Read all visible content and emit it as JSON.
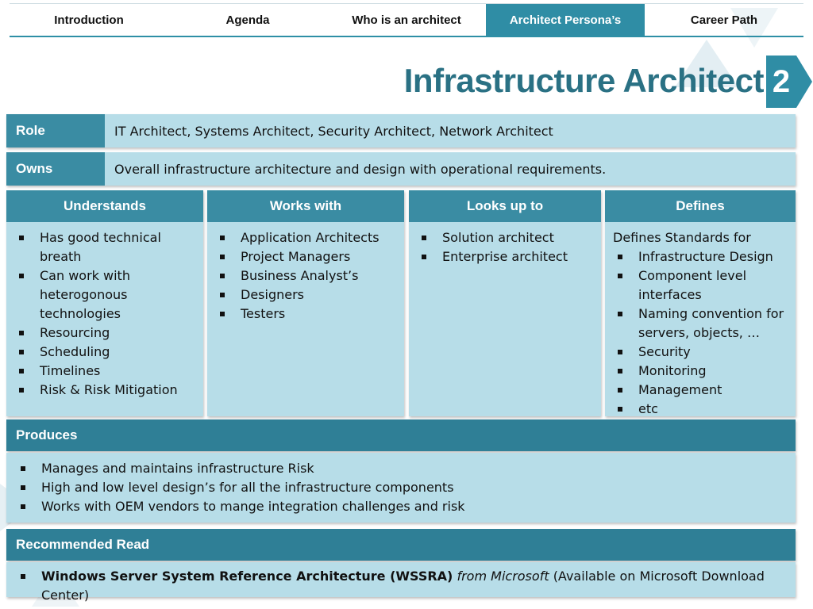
{
  "nav": {
    "tabs": [
      {
        "label": "Introduction"
      },
      {
        "label": "Agenda"
      },
      {
        "label": "Who is an architect"
      },
      {
        "label": "Architect Persona’s"
      },
      {
        "label": "Career Path"
      }
    ]
  },
  "title": "Infrastructure Architect",
  "slide_number": "2",
  "role": {
    "label": "Role",
    "text": "IT Architect, Systems Architect, Security Architect, Network Architect"
  },
  "owns": {
    "label": "Owns",
    "text": "Overall infrastructure architecture and design with operational requirements."
  },
  "columns": {
    "understands": {
      "header": "Understands",
      "items": [
        "Has good technical breath",
        "Can work with heterogonous technologies",
        "Resourcing",
        "Scheduling",
        "Timelines",
        "Risk & Risk Mitigation"
      ]
    },
    "works_with": {
      "header": "Works with",
      "items": [
        "Application Architects",
        "Project Managers",
        "Business Analyst’s",
        "Designers",
        "Testers"
      ]
    },
    "looks_up_to": {
      "header": "Looks up to",
      "items": [
        "Solution architect",
        "Enterprise architect"
      ]
    },
    "defines": {
      "header": "Defines",
      "intro": "Defines Standards for",
      "items": [
        "Infrastructure Design",
        "Component level interfaces",
        "Naming convention for servers, objects, …",
        "Security",
        "Monitoring",
        "Management",
        "etc"
      ]
    }
  },
  "produces": {
    "header": "Produces",
    "items": [
      "Manages and maintains infrastructure Risk",
      "High and low level design’s for all the infrastructure components",
      "Works with OEM vendors to mange integration challenges and risk"
    ]
  },
  "recommended": {
    "header": "Recommended Read",
    "title": "Windows Server System Reference Architecture (WSSRA)",
    "source": "from Microsoft",
    "note": "(Available on Microsoft Download Center)"
  },
  "colors": {
    "accent": "#2f8da5",
    "panel": "#b7dde8",
    "title": "#2a7184"
  }
}
